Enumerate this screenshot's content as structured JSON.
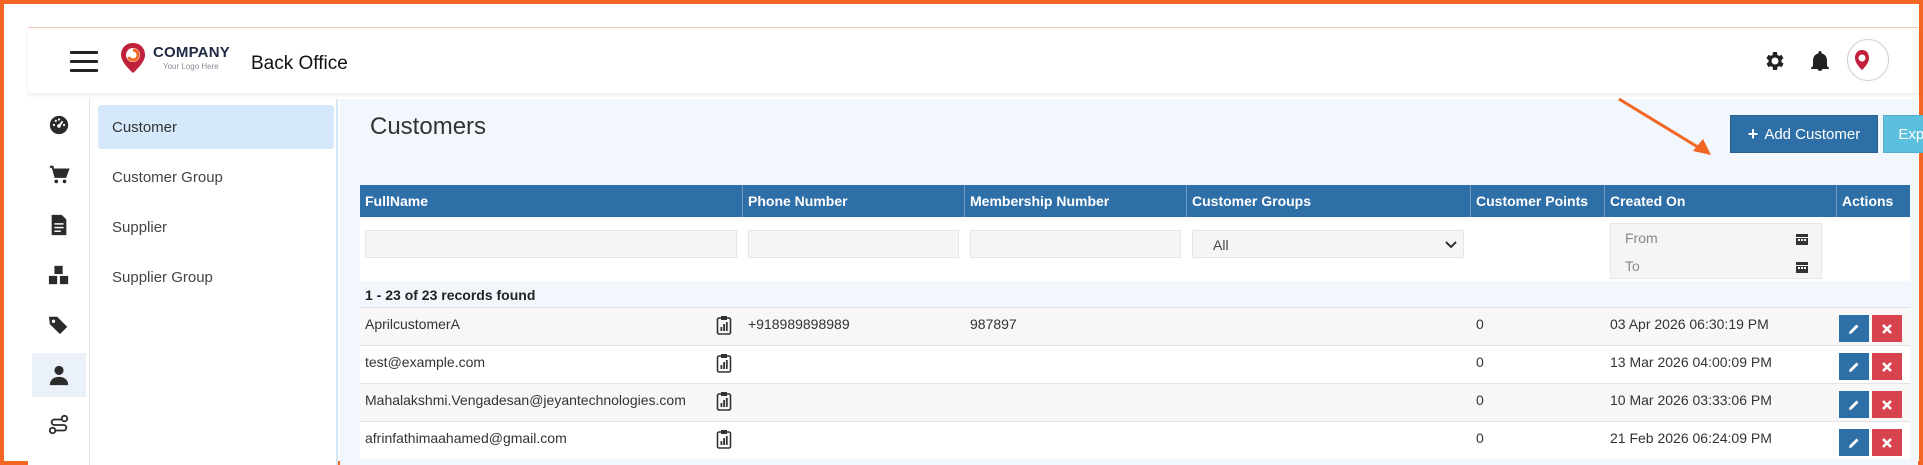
{
  "header": {
    "logo_name": "COMPANY",
    "logo_tagline": "Your Logo Here",
    "app_title": "Back Office",
    "avatar_text": "COMPANY",
    "icons": [
      "menu-icon",
      "gear-icon",
      "bell-icon"
    ]
  },
  "rail": {
    "items": [
      {
        "icon": "dashboard-icon",
        "active": false
      },
      {
        "icon": "cart-icon",
        "active": false
      },
      {
        "icon": "document-icon",
        "active": false
      },
      {
        "icon": "boxes-icon",
        "active": false
      },
      {
        "icon": "tags-icon",
        "active": false
      },
      {
        "icon": "user-icon",
        "active": true
      },
      {
        "icon": "route-icon",
        "active": false
      }
    ]
  },
  "submenu": {
    "items": [
      {
        "label": "Customer",
        "active": true
      },
      {
        "label": "Customer Group",
        "active": false
      },
      {
        "label": "Supplier",
        "active": false
      },
      {
        "label": "Supplier Group",
        "active": false
      }
    ]
  },
  "main": {
    "title": "Customers",
    "add_label": "Add Customer",
    "export_label": "Export",
    "columns": [
      "FullName",
      "Phone Number",
      "Membership Number",
      "Customer Groups",
      "Customer Points",
      "Created On",
      "Actions"
    ],
    "filters": {
      "group_selected": "All",
      "date_from_placeholder": "From",
      "date_to_placeholder": "To"
    },
    "records_text": "1 - 23 of 23 records found",
    "rows": [
      {
        "fullname": "AprilcustomerA",
        "phone": "+918989898989",
        "membership": "987897",
        "groups": "",
        "points": "0",
        "created": "03 Apr 2026 06:30:19 PM"
      },
      {
        "fullname": "test@example.com",
        "phone": "",
        "membership": "",
        "groups": "",
        "points": "0",
        "created": "13 Mar 2026 04:00:09 PM"
      },
      {
        "fullname": "Mahalakshmi.Vengadesan@jeyantechnologies.com",
        "phone": "",
        "membership": "",
        "groups": "",
        "points": "0",
        "created": "10 Mar 2026 03:33:06 PM"
      },
      {
        "fullname": "afrinfathimaahamed@gmail.com",
        "phone": "",
        "membership": "",
        "groups": "",
        "points": "0",
        "created": "21 Feb 2026 06:24:09 PM"
      }
    ]
  },
  "colors": {
    "frame": "#f26522",
    "primary": "#2f6fa7",
    "export": "#5bc0de",
    "delete": "#d9434e",
    "active_bg": "#d6e8fb"
  }
}
